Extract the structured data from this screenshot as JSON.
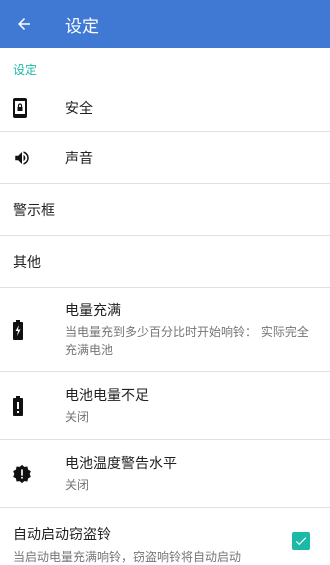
{
  "appbar": {
    "title": "设定"
  },
  "section": {
    "header": "设定"
  },
  "rows": [
    {
      "label": "安全"
    },
    {
      "label": "声音"
    },
    {
      "label": "警示框"
    },
    {
      "label": "其他"
    },
    {
      "label": "电量充满",
      "sub": "当电量充到多少百分比时开始响铃： 实际完全充满电池"
    },
    {
      "label": "电池电量不足",
      "sub": "关闭"
    },
    {
      "label": "电池温度警告水平",
      "sub": "关闭"
    }
  ],
  "anti_theft": {
    "label": "自动启动窃盗铃",
    "sub": "当启动电量充满响铃，窃盗响铃将自动启动",
    "checked": true
  },
  "colors": {
    "appbar": "#3f79d4",
    "accent": "#1bb9a6"
  }
}
